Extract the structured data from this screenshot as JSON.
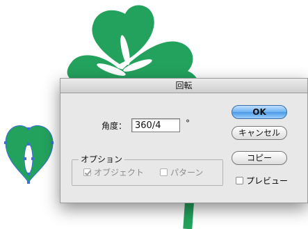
{
  "dialog": {
    "title": "回転",
    "angle_label": "角度：",
    "angle_value": "360/4",
    "degree_symbol": "°",
    "options_group_label": "オプション",
    "object_checkbox": {
      "label": "オブジェクト",
      "checked": true,
      "enabled": false
    },
    "pattern_checkbox": {
      "label": "パターン",
      "checked": false,
      "enabled": false
    },
    "ok_label": "OK",
    "cancel_label": "キャンセル",
    "copy_label": "コピー",
    "preview_checkbox": {
      "label": "プレビュー",
      "checked": false
    }
  },
  "colors": {
    "clover_green": "#23a25d",
    "selection_blue": "#3d6ed6",
    "ok_button_blue": "#6fb2f0"
  }
}
